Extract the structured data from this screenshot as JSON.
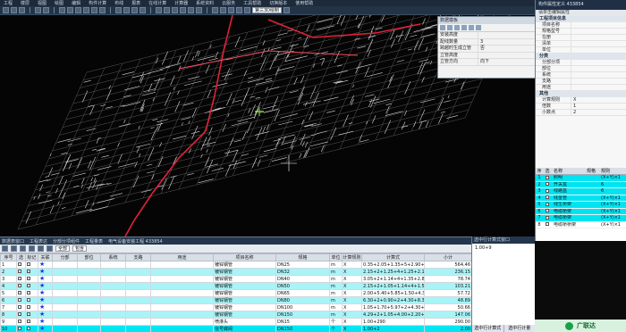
{
  "menubar": {
    "items": [
      "工程",
      "楼层",
      "视图",
      "绘图",
      "编辑",
      "构件计算",
      "布线",
      "报表",
      "在线计算",
      "计算器",
      "系统资料",
      "云服务",
      "工具帮助",
      "切换版本",
      "使用帮助"
    ]
  },
  "toolbar": {
    "view_combo": "第三3D绘制"
  },
  "popup": {
    "title": "数据模板",
    "rows": [
      {
        "key": "安装高度",
        "value": ""
      },
      {
        "key": "配线数量",
        "value": "3"
      },
      {
        "key": "跨越时生成立管",
        "value": "否"
      },
      {
        "key": "立管高度",
        "value": ""
      },
      {
        "key": "立管方向",
        "value": "向下"
      }
    ]
  },
  "properties": {
    "title": "构件属性定义 433854",
    "subtitle": "请单击编辑属性",
    "groups": [
      {
        "name": "工程项目信息",
        "rows": [
          {
            "key": "项目名称",
            "value": ""
          },
          {
            "key": "规格型号",
            "value": ""
          },
          {
            "key": "在册",
            "value": ""
          },
          {
            "key": "清单",
            "value": ""
          },
          {
            "key": "单位",
            "value": ""
          }
        ]
      },
      {
        "name": "分类",
        "rows": [
          {
            "key": "分部分项",
            "value": ""
          },
          {
            "key": "部位",
            "value": ""
          },
          {
            "key": "系统",
            "value": ""
          },
          {
            "key": "支路",
            "value": ""
          },
          {
            "key": "用途",
            "value": ""
          }
        ]
      },
      {
        "name": "其他",
        "rows": [
          {
            "key": "计算规则",
            "value": "X"
          },
          {
            "key": "倍数",
            "value": "1"
          },
          {
            "key": "小数点",
            "value": "2"
          }
        ]
      }
    ]
  },
  "layers": {
    "headers": [
      "序",
      "选",
      "名称",
      "规格",
      "规则"
    ],
    "rows": [
      {
        "no": "1",
        "name": "照明",
        "spec": "",
        "rule": "(X+Y)×1"
      },
      {
        "no": "2",
        "name": "开关盒",
        "spec": "",
        "rule": "6"
      },
      {
        "no": "3",
        "name": "线路盒",
        "spec": "",
        "rule": "6"
      },
      {
        "no": "4",
        "name": "线金管",
        "spec": "",
        "rule": "(X+Y)×1"
      },
      {
        "no": "5",
        "name": "线生桥架",
        "spec": "",
        "rule": "(X+Y)×1"
      },
      {
        "no": "6",
        "name": "电缆桥架",
        "spec": "",
        "rule": "(X+Y)×1"
      },
      {
        "no": "7",
        "name": "电缆桥架",
        "spec": "",
        "rule": "(X+Y)×1"
      },
      {
        "no": "8",
        "name": "电缆桥桥架",
        "spec": "",
        "rule": "(X+Y)×1"
      }
    ]
  },
  "bottom": {
    "tabs": [
      "数据表窗口",
      "工程表达",
      "分部分项组件",
      "工程量表",
      "电气设备安装工程 433854"
    ],
    "filter_combo_1": "全部",
    "filter_combo_2": "包含",
    "headers": [
      "序号",
      "选",
      "标记",
      "关联",
      "分部",
      "部位",
      "系统",
      "支路",
      "用途",
      "项目名称",
      "规格",
      "单位",
      "计算规则",
      "计算式",
      "小计"
    ],
    "rows": [
      {
        "no": "1",
        "name": "镀锌钢管",
        "spec": "DN25",
        "unit": "m",
        "rule": "X",
        "expr": "0.35+2.05+1.35+5+2.90+8+",
        "total": "564.46"
      },
      {
        "no": "2",
        "name": "镀锌钢管",
        "spec": "DN32",
        "unit": "m",
        "rule": "X",
        "expr": "2.15+2+1.25+4+1.25+2.16+",
        "total": "236.15"
      },
      {
        "no": "3",
        "name": "镀锌钢管",
        "spec": "DN40",
        "unit": "m",
        "rule": "X",
        "expr": "3.05+2+1.14+4+1.35+2.80+",
        "total": "78.74"
      },
      {
        "no": "4",
        "name": "镀锌钢管",
        "spec": "DN50",
        "unit": "m",
        "rule": "X",
        "expr": "2.15+2+1.05+1.14+4+1.57+",
        "total": "103.21"
      },
      {
        "no": "5",
        "name": "镀锌钢管",
        "spec": "DN65",
        "unit": "m",
        "rule": "X",
        "expr": "2.00+5.40+5.85+1.50+4.30+",
        "total": "57.72"
      },
      {
        "no": "6",
        "name": "镀锌钢管",
        "spec": "DN80",
        "unit": "m",
        "rule": "X",
        "expr": "6.30+2+0.90+2+4.30+8.30+",
        "total": "48.89"
      },
      {
        "no": "7",
        "name": "镀锌钢管",
        "spec": "DN100",
        "unit": "m",
        "rule": "X",
        "expr": "1.05+1.70+5.97+2+4.30+",
        "total": "50.66"
      },
      {
        "no": "8",
        "name": "镀锌钢管",
        "spec": "DN150",
        "unit": "m",
        "rule": "X",
        "expr": "4.29+2+1.05+4.00+2.20+5+",
        "total": "147.06"
      },
      {
        "no": "9",
        "name": "喷淋头",
        "spec": "DN15",
        "unit": "个",
        "rule": "X",
        "expr": "1.00+290",
        "total": "290.00"
      },
      {
        "no": "10",
        "name": "信号蝶阀",
        "spec": "DN150",
        "unit": "个",
        "rule": "X",
        "expr": "1.00+2",
        "total": "2.00"
      }
    ]
  },
  "expression_panel": {
    "title": "选中行计算式窗口",
    "value": "1.00+9",
    "tabs": [
      "选中行计算式",
      "选中行计量"
    ]
  },
  "logo": {
    "text": "广联达"
  },
  "colors": {
    "accent": "#00e6f4",
    "pipe_red": "#e0203a",
    "chrome": "#23364d"
  }
}
